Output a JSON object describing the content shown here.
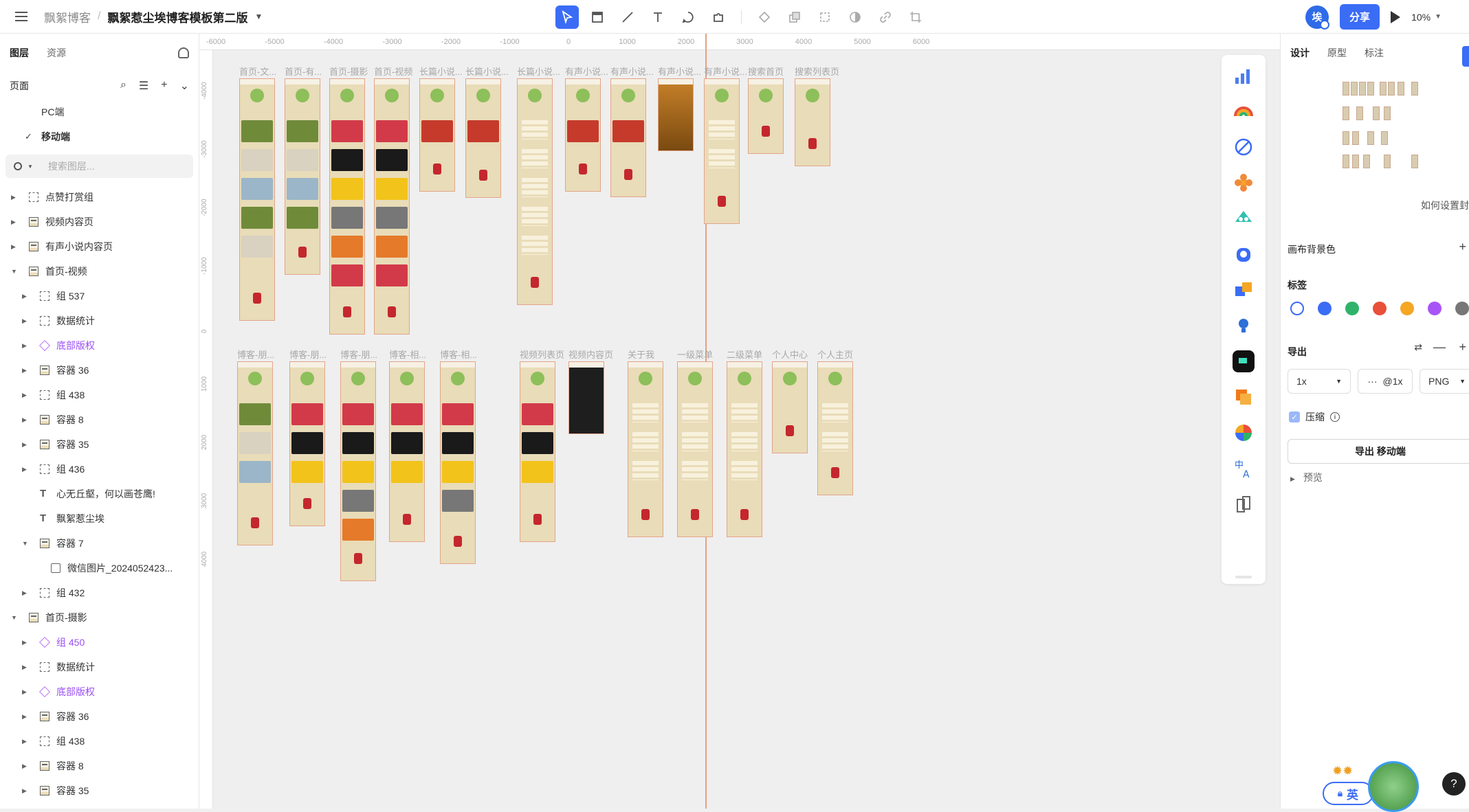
{
  "topbar": {
    "breadcrumb_team": "飘絮博客",
    "breadcrumb_sep": "/",
    "file_title": "飘絮惹尘埃博客模板第二版",
    "avatar_text": "埃",
    "share_label": "分享",
    "zoom_value": "10%"
  },
  "left": {
    "tabs": [
      "图层",
      "资源"
    ],
    "pages_title": "页面",
    "pages": [
      {
        "label": "PC端",
        "selected": false
      },
      {
        "label": "移动端",
        "selected": true
      }
    ],
    "search_placeholder": "搜索图层...",
    "layers": [
      {
        "label": "点赞打赏组",
        "type": "group",
        "depth": 0,
        "open": false,
        "purple": false
      },
      {
        "label": "视频内容页",
        "type": "frame",
        "depth": 0,
        "open": false,
        "purple": false
      },
      {
        "label": "有声小说内容页",
        "type": "frame",
        "depth": 0,
        "open": false,
        "purple": false
      },
      {
        "label": "首页-视频",
        "type": "frame",
        "depth": 0,
        "open": true,
        "purple": false
      },
      {
        "label": "组 537",
        "type": "group",
        "depth": 1,
        "open": false,
        "purple": false
      },
      {
        "label": "数据统计",
        "type": "group",
        "depth": 1,
        "open": false,
        "purple": false
      },
      {
        "label": "底部版权",
        "type": "comp",
        "depth": 1,
        "open": false,
        "purple": true
      },
      {
        "label": "容器 36",
        "type": "frame",
        "depth": 1,
        "open": false,
        "purple": false
      },
      {
        "label": "组 438",
        "type": "group",
        "depth": 1,
        "open": false,
        "purple": false
      },
      {
        "label": "容器 8",
        "type": "frame",
        "depth": 1,
        "open": false,
        "purple": false
      },
      {
        "label": "容器 35",
        "type": "frame",
        "depth": 1,
        "open": false,
        "purple": false
      },
      {
        "label": "组 436",
        "type": "group",
        "depth": 1,
        "open": false,
        "purple": false
      },
      {
        "label": "心无丘壑，何以画苍鹰!",
        "type": "text",
        "depth": 1,
        "open": null,
        "purple": false
      },
      {
        "label": "飘絮惹尘埃",
        "type": "text",
        "depth": 1,
        "open": null,
        "purple": false
      },
      {
        "label": "容器 7",
        "type": "frame",
        "depth": 1,
        "open": true,
        "purple": false
      },
      {
        "label": "微信图片_2024052423...",
        "type": "img",
        "depth": 2,
        "open": null,
        "purple": false
      },
      {
        "label": "组 432",
        "type": "group",
        "depth": 1,
        "open": false,
        "purple": false
      },
      {
        "label": "首页-摄影",
        "type": "frame",
        "depth": 0,
        "open": true,
        "purple": false
      },
      {
        "label": "组 450",
        "type": "comp",
        "depth": 1,
        "open": false,
        "purple": true
      },
      {
        "label": "数据统计",
        "type": "group",
        "depth": 1,
        "open": false,
        "purple": false
      },
      {
        "label": "底部版权",
        "type": "comp",
        "depth": 1,
        "open": false,
        "purple": true
      },
      {
        "label": "容器 36",
        "type": "frame",
        "depth": 1,
        "open": false,
        "purple": false
      },
      {
        "label": "组 438",
        "type": "group",
        "depth": 1,
        "open": false,
        "purple": false
      },
      {
        "label": "容器 8",
        "type": "frame",
        "depth": 1,
        "open": false,
        "purple": false
      },
      {
        "label": "容器 35",
        "type": "frame",
        "depth": 1,
        "open": false,
        "purple": false
      }
    ]
  },
  "canvas": {
    "ruler_h": [
      "-6000",
      "-5000",
      "-4000",
      "-3000",
      "-2000",
      "-1000",
      "0",
      "1000",
      "2000",
      "3000",
      "4000",
      "5000",
      "6000"
    ],
    "ruler_v": [
      "-4000",
      "-3000",
      "-2000",
      "-1000",
      "0",
      "1000",
      "2000",
      "3000",
      "4000"
    ],
    "frame_labels_row1": [
      "首页-文...",
      "首页-有...",
      "首页-摄影",
      "首页-视频",
      "长篇小说...",
      "长篇小说...",
      "长篇小说...",
      "有声小说...",
      "有声小说...",
      "有声小说...",
      "有声小说...",
      "搜索首页",
      "搜索列表页"
    ],
    "frame_labels_row2": [
      "博客-朋...",
      "博客-朋...",
      "博客-朋...",
      "博客-相...",
      "博客-相...",
      "视频列表页",
      "视频内容页",
      "关于我",
      "一级菜单",
      "二级菜单",
      "个人中心",
      "个人主页"
    ]
  },
  "right": {
    "tabs": [
      "设计",
      "原型",
      "标注"
    ],
    "help_link": "如何设置封",
    "canvas_bg_label": "画布背景色",
    "tags_label": "标签",
    "tag_colors": [
      "#ffffff",
      "#3b6cf6",
      "#2fb36b",
      "#e8503a",
      "#f5a623",
      "#a855f7",
      "#777777"
    ],
    "export_label": "导出",
    "export_scale": "1x",
    "export_suffix": "@1x",
    "export_format": "PNG",
    "compress_label": "压缩",
    "export_button": "导出 移动端",
    "preview_label": "预览"
  },
  "floating": {
    "ime_label": "英",
    "help": "?"
  },
  "colors": {
    "accent": "#3b6cf6",
    "frame_bg": "#e9dcb8",
    "frame_border": "#e3a48a",
    "center_guide": "#e8a07f"
  }
}
